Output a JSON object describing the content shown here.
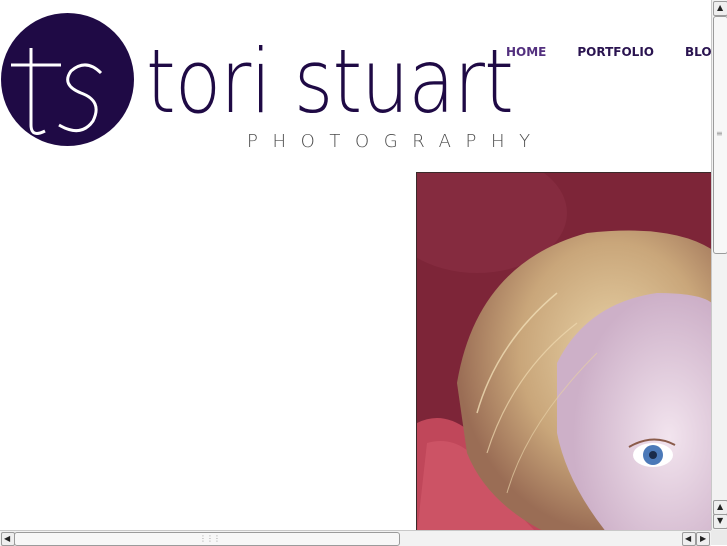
{
  "brand": {
    "monogram": "ts",
    "name": "tori stuart",
    "tagline": "PHOTOGRAPHY",
    "circle_color": "#1f0a45",
    "text_color": "#1f0a45"
  },
  "nav": {
    "items": [
      {
        "label": "HOME",
        "active": true
      },
      {
        "label": "PORTFOLIO",
        "active": false
      },
      {
        "label": "BLOG",
        "active": false
      }
    ]
  },
  "hero": {
    "photo_icon": "child-portrait-photo",
    "background_color": "#7a2336"
  },
  "scrollbars": {
    "vertical_icon_up": "arrow-up-icon",
    "vertical_icon_down": "arrow-down-icon",
    "horizontal_icon_left": "arrow-left-icon",
    "horizontal_icon_right": "arrow-right-icon"
  }
}
